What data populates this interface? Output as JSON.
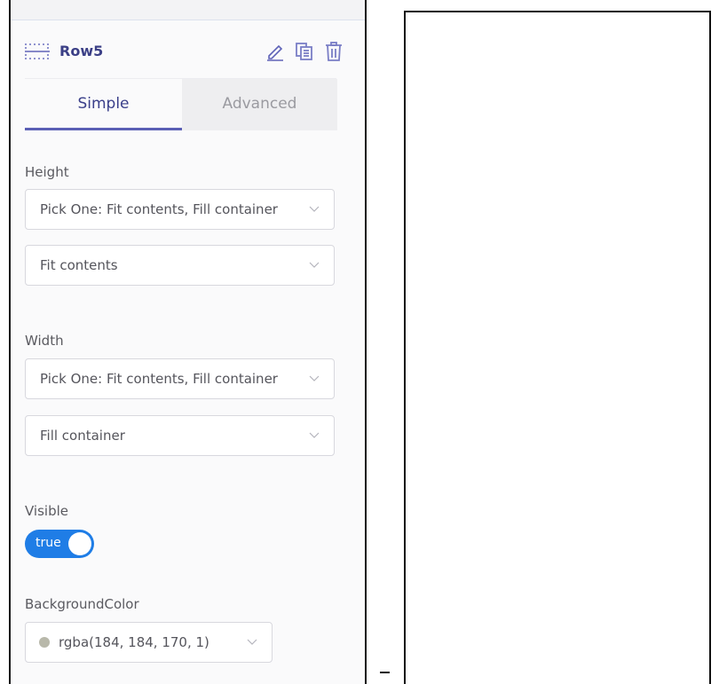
{
  "component": {
    "title": "Row5",
    "icons": {
      "row": "row-grid-icon",
      "edit": "pencil-icon",
      "duplicate": "copy-icon",
      "delete": "trash-icon"
    }
  },
  "tabs": [
    {
      "label": "Simple",
      "active": true
    },
    {
      "label": "Advanced",
      "active": false
    }
  ],
  "fields": {
    "height": {
      "label": "Height",
      "mode_select": "Pick One: Fit contents, Fill container",
      "value_select": "Fit contents"
    },
    "width": {
      "label": "Width",
      "mode_select": "Pick One: Fit contents, Fill container",
      "value_select": "Fill container"
    },
    "visible": {
      "label": "Visible",
      "toggle_text": "true",
      "toggle_on": true
    },
    "background_color": {
      "label": "BackgroundColor",
      "value": "rgba(184, 184, 170, 1)",
      "swatch": "#b8b8aa"
    }
  },
  "colors": {
    "accent": "#3b3f86",
    "toggle_on": "#1f7de6",
    "tab_underline": "#5b5fb5"
  }
}
